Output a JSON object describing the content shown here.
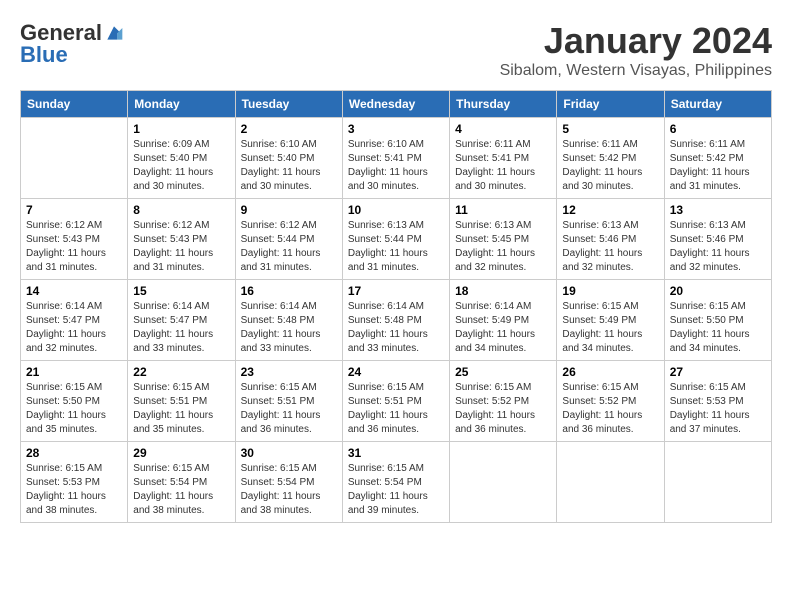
{
  "logo": {
    "general": "General",
    "blue": "Blue"
  },
  "title": "January 2024",
  "location": "Sibalom, Western Visayas, Philippines",
  "days_of_week": [
    "Sunday",
    "Monday",
    "Tuesday",
    "Wednesday",
    "Thursday",
    "Friday",
    "Saturday"
  ],
  "weeks": [
    [
      {
        "day": "",
        "sunrise": "",
        "sunset": "",
        "daylight": ""
      },
      {
        "day": "1",
        "sunrise": "Sunrise: 6:09 AM",
        "sunset": "Sunset: 5:40 PM",
        "daylight": "Daylight: 11 hours and 30 minutes."
      },
      {
        "day": "2",
        "sunrise": "Sunrise: 6:10 AM",
        "sunset": "Sunset: 5:40 PM",
        "daylight": "Daylight: 11 hours and 30 minutes."
      },
      {
        "day": "3",
        "sunrise": "Sunrise: 6:10 AM",
        "sunset": "Sunset: 5:41 PM",
        "daylight": "Daylight: 11 hours and 30 minutes."
      },
      {
        "day": "4",
        "sunrise": "Sunrise: 6:11 AM",
        "sunset": "Sunset: 5:41 PM",
        "daylight": "Daylight: 11 hours and 30 minutes."
      },
      {
        "day": "5",
        "sunrise": "Sunrise: 6:11 AM",
        "sunset": "Sunset: 5:42 PM",
        "daylight": "Daylight: 11 hours and 30 minutes."
      },
      {
        "day": "6",
        "sunrise": "Sunrise: 6:11 AM",
        "sunset": "Sunset: 5:42 PM",
        "daylight": "Daylight: 11 hours and 31 minutes."
      }
    ],
    [
      {
        "day": "7",
        "sunrise": "Sunrise: 6:12 AM",
        "sunset": "Sunset: 5:43 PM",
        "daylight": "Daylight: 11 hours and 31 minutes."
      },
      {
        "day": "8",
        "sunrise": "Sunrise: 6:12 AM",
        "sunset": "Sunset: 5:43 PM",
        "daylight": "Daylight: 11 hours and 31 minutes."
      },
      {
        "day": "9",
        "sunrise": "Sunrise: 6:12 AM",
        "sunset": "Sunset: 5:44 PM",
        "daylight": "Daylight: 11 hours and 31 minutes."
      },
      {
        "day": "10",
        "sunrise": "Sunrise: 6:13 AM",
        "sunset": "Sunset: 5:44 PM",
        "daylight": "Daylight: 11 hours and 31 minutes."
      },
      {
        "day": "11",
        "sunrise": "Sunrise: 6:13 AM",
        "sunset": "Sunset: 5:45 PM",
        "daylight": "Daylight: 11 hours and 32 minutes."
      },
      {
        "day": "12",
        "sunrise": "Sunrise: 6:13 AM",
        "sunset": "Sunset: 5:46 PM",
        "daylight": "Daylight: 11 hours and 32 minutes."
      },
      {
        "day": "13",
        "sunrise": "Sunrise: 6:13 AM",
        "sunset": "Sunset: 5:46 PM",
        "daylight": "Daylight: 11 hours and 32 minutes."
      }
    ],
    [
      {
        "day": "14",
        "sunrise": "Sunrise: 6:14 AM",
        "sunset": "Sunset: 5:47 PM",
        "daylight": "Daylight: 11 hours and 32 minutes."
      },
      {
        "day": "15",
        "sunrise": "Sunrise: 6:14 AM",
        "sunset": "Sunset: 5:47 PM",
        "daylight": "Daylight: 11 hours and 33 minutes."
      },
      {
        "day": "16",
        "sunrise": "Sunrise: 6:14 AM",
        "sunset": "Sunset: 5:48 PM",
        "daylight": "Daylight: 11 hours and 33 minutes."
      },
      {
        "day": "17",
        "sunrise": "Sunrise: 6:14 AM",
        "sunset": "Sunset: 5:48 PM",
        "daylight": "Daylight: 11 hours and 33 minutes."
      },
      {
        "day": "18",
        "sunrise": "Sunrise: 6:14 AM",
        "sunset": "Sunset: 5:49 PM",
        "daylight": "Daylight: 11 hours and 34 minutes."
      },
      {
        "day": "19",
        "sunrise": "Sunrise: 6:15 AM",
        "sunset": "Sunset: 5:49 PM",
        "daylight": "Daylight: 11 hours and 34 minutes."
      },
      {
        "day": "20",
        "sunrise": "Sunrise: 6:15 AM",
        "sunset": "Sunset: 5:50 PM",
        "daylight": "Daylight: 11 hours and 34 minutes."
      }
    ],
    [
      {
        "day": "21",
        "sunrise": "Sunrise: 6:15 AM",
        "sunset": "Sunset: 5:50 PM",
        "daylight": "Daylight: 11 hours and 35 minutes."
      },
      {
        "day": "22",
        "sunrise": "Sunrise: 6:15 AM",
        "sunset": "Sunset: 5:51 PM",
        "daylight": "Daylight: 11 hours and 35 minutes."
      },
      {
        "day": "23",
        "sunrise": "Sunrise: 6:15 AM",
        "sunset": "Sunset: 5:51 PM",
        "daylight": "Daylight: 11 hours and 36 minutes."
      },
      {
        "day": "24",
        "sunrise": "Sunrise: 6:15 AM",
        "sunset": "Sunset: 5:51 PM",
        "daylight": "Daylight: 11 hours and 36 minutes."
      },
      {
        "day": "25",
        "sunrise": "Sunrise: 6:15 AM",
        "sunset": "Sunset: 5:52 PM",
        "daylight": "Daylight: 11 hours and 36 minutes."
      },
      {
        "day": "26",
        "sunrise": "Sunrise: 6:15 AM",
        "sunset": "Sunset: 5:52 PM",
        "daylight": "Daylight: 11 hours and 36 minutes."
      },
      {
        "day": "27",
        "sunrise": "Sunrise: 6:15 AM",
        "sunset": "Sunset: 5:53 PM",
        "daylight": "Daylight: 11 hours and 37 minutes."
      }
    ],
    [
      {
        "day": "28",
        "sunrise": "Sunrise: 6:15 AM",
        "sunset": "Sunset: 5:53 PM",
        "daylight": "Daylight: 11 hours and 38 minutes."
      },
      {
        "day": "29",
        "sunrise": "Sunrise: 6:15 AM",
        "sunset": "Sunset: 5:54 PM",
        "daylight": "Daylight: 11 hours and 38 minutes."
      },
      {
        "day": "30",
        "sunrise": "Sunrise: 6:15 AM",
        "sunset": "Sunset: 5:54 PM",
        "daylight": "Daylight: 11 hours and 38 minutes."
      },
      {
        "day": "31",
        "sunrise": "Sunrise: 6:15 AM",
        "sunset": "Sunset: 5:54 PM",
        "daylight": "Daylight: 11 hours and 39 minutes."
      },
      {
        "day": "",
        "sunrise": "",
        "sunset": "",
        "daylight": ""
      },
      {
        "day": "",
        "sunrise": "",
        "sunset": "",
        "daylight": ""
      },
      {
        "day": "",
        "sunrise": "",
        "sunset": "",
        "daylight": ""
      }
    ]
  ]
}
